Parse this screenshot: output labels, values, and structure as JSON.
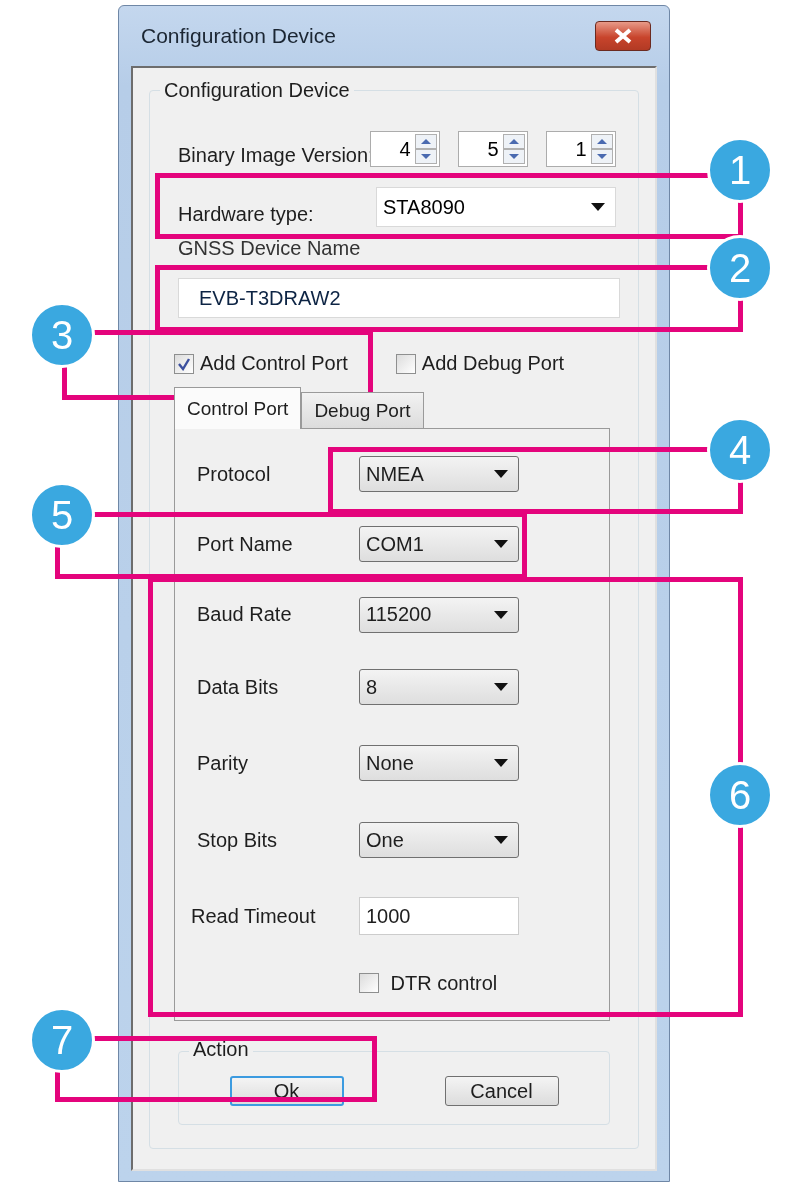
{
  "window": {
    "title": "Configuration Device"
  },
  "group": {
    "title": "Configuration Device"
  },
  "version": {
    "label": "Binary Image Version:",
    "spinners": [
      {
        "value": "4"
      },
      {
        "value": "5"
      },
      {
        "value": "1"
      }
    ]
  },
  "hardware": {
    "label": "Hardware type:",
    "value": "STA8090"
  },
  "device_name": {
    "label": "GNSS Device Name",
    "value": "EVB-T3DRAW2"
  },
  "checkboxes": [
    {
      "label": "Add Control Port",
      "checked": true
    },
    {
      "label": "Add Debug Port",
      "checked": false
    }
  ],
  "tabs": [
    {
      "label": "Control Port",
      "selected": true
    },
    {
      "label": "Debug Port",
      "selected": false
    }
  ],
  "fields": [
    {
      "kind": "combo",
      "label": "Protocol",
      "value": "NMEA"
    },
    {
      "kind": "combo",
      "label": "Port Name",
      "value": "COM1"
    },
    {
      "kind": "combo",
      "label": "Baud Rate",
      "value": "115200"
    },
    {
      "kind": "combo",
      "label": "Data Bits",
      "value": "8"
    },
    {
      "kind": "combo",
      "label": "Parity",
      "value": "None"
    },
    {
      "kind": "combo",
      "label": "Stop Bits",
      "value": "One"
    },
    {
      "kind": "text",
      "label": "Read Timeout",
      "value": "1000"
    },
    {
      "kind": "checkbox",
      "label": "DTR control",
      "checked": false
    }
  ],
  "action": {
    "title": "Action",
    "buttons": [
      {
        "label": "Ok",
        "default": true
      },
      {
        "label": "Cancel",
        "default": false
      }
    ]
  },
  "callouts": [
    {
      "number": "1"
    },
    {
      "number": "2"
    },
    {
      "number": "3"
    },
    {
      "number": "4"
    },
    {
      "number": "5"
    },
    {
      "number": "6"
    },
    {
      "number": "7"
    }
  ]
}
